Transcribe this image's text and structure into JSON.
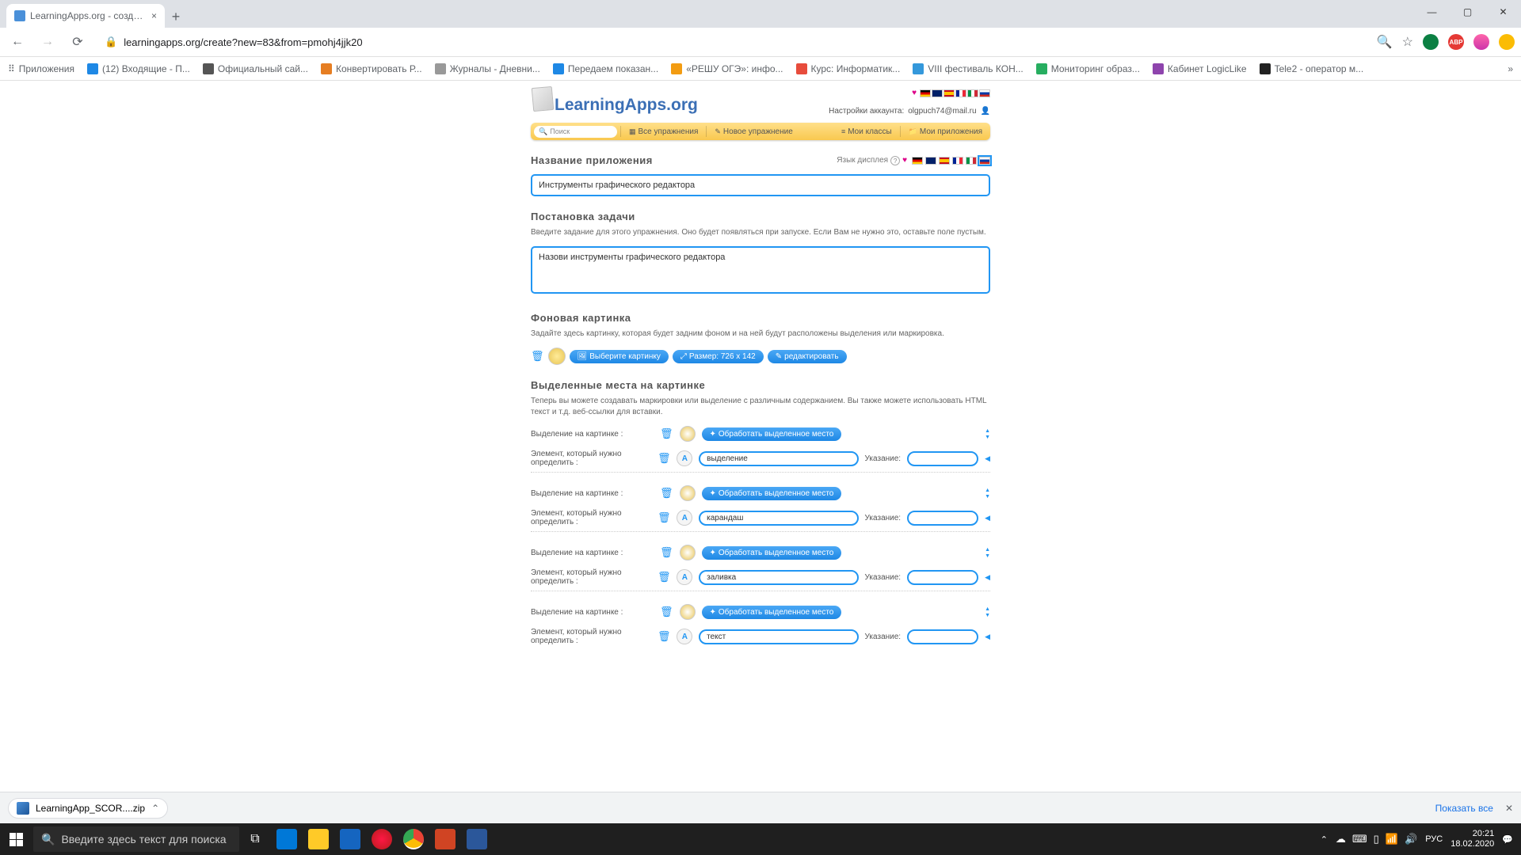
{
  "browser": {
    "tab_title": "LearningApps.org - создание м...",
    "url": "learningapps.org/create?new=83&from=pmohj4jjk20",
    "bookmarks_label": "Приложения",
    "bookmarks": [
      {
        "label": "(12) Входящие - П...",
        "color": "#1e88e5"
      },
      {
        "label": "Официальный сай...",
        "color": "#555"
      },
      {
        "label": "Конвертировать Р...",
        "color": "#e67e22"
      },
      {
        "label": "Журналы - Дневни...",
        "color": "#999"
      },
      {
        "label": "Передаем показан...",
        "color": "#1e88e5"
      },
      {
        "label": "«РЕШУ ОГЭ»: инфо...",
        "color": "#f39c12"
      },
      {
        "label": "Курс: Информатик...",
        "color": "#e74c3c"
      },
      {
        "label": "VIII фестиваль КОН...",
        "color": "#3498db"
      },
      {
        "label": "Мониторинг образ...",
        "color": "#27ae60"
      },
      {
        "label": "Кабинет LogicLike",
        "color": "#8e44ad"
      },
      {
        "label": "Tele2 - оператор м...",
        "color": "#222"
      }
    ]
  },
  "site": {
    "logo": "LearningApps.org",
    "account_label": "Настройки аккаунта:",
    "account_email": "olgpuch74@mail.ru",
    "search_placeholder": "Поиск",
    "nav": {
      "all": "Все упражнения",
      "new": "Новое упражнение",
      "classes": "Мои классы",
      "apps": "Мои приложения"
    },
    "lang_display": "Язык дисплея"
  },
  "form": {
    "title_label": "Название приложения",
    "title_value": "Инструменты графического редактора",
    "task_label": "Постановка задачи",
    "task_desc": "Введите задание для этого упражнения. Оно будет появляться при запуске. Если Вам не нужно это, оставьте поле пустым.",
    "task_value": "Назови инструменты графического редактора",
    "bg_label": "Фоновая картинка",
    "bg_desc": "Задайте здесь картинку, которая будет задним фоном и на ней будут расположены выделения или маркировка.",
    "select_image": "Выберите картинку",
    "size_label": "Размер: 726 x 142",
    "edit_label": "редактировать",
    "marks_label": "Выделенные места на картинке",
    "marks_desc": "Теперь вы можете создавать маркировки или выделение с различным содержанием. Вы также можете использовать HTML текст и т.д. веб-ссылки для вставки.",
    "row_mark": "Выделение на картинке :",
    "row_elem": "Элемент, который нужно определить :",
    "hint": "Указание:",
    "process_btn": "Обработать выделенное место",
    "items": [
      {
        "value": "выделение"
      },
      {
        "value": "карандаш"
      },
      {
        "value": "заливка"
      },
      {
        "value": "текст"
      }
    ]
  },
  "downloads": {
    "file": "LearningApp_SCOR....zip",
    "show_all": "Показать все"
  },
  "taskbar": {
    "search_placeholder": "Введите здесь текст для поиска",
    "lang": "РУС",
    "time": "20:21",
    "date": "18.02.2020"
  }
}
